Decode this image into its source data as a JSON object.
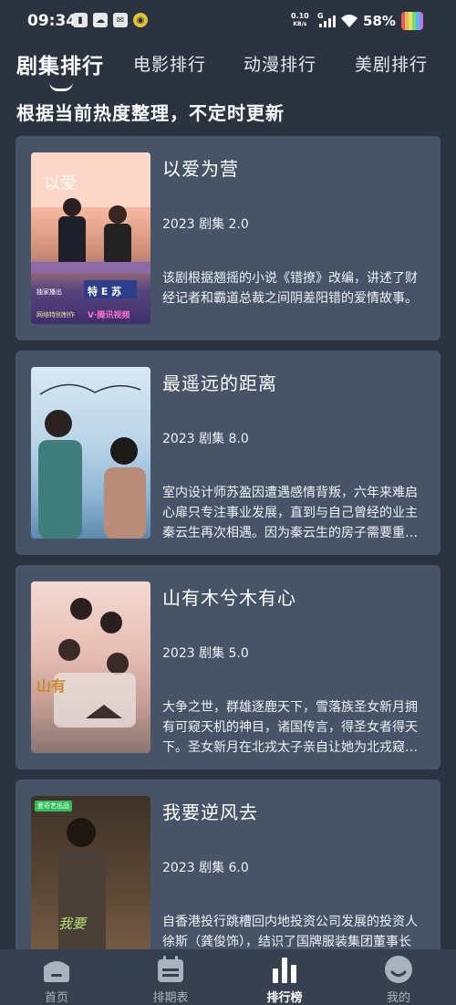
{
  "status_bar": {
    "time": "09:34",
    "net_speed_value": "0.10",
    "net_speed_unit": "KB/s",
    "network_label": "G",
    "battery": "58%"
  },
  "tabs": [
    {
      "label": "剧集排行",
      "active": true
    },
    {
      "label": "电影排行",
      "active": false
    },
    {
      "label": "动漫排行",
      "active": false
    },
    {
      "label": "美剧排行",
      "active": false
    }
  ],
  "subtitle": "根据当前热度整理，不定时更新",
  "items": [
    {
      "title": "以爱为营",
      "meta": "2023 剧集 2.0",
      "description": "该剧根据翘摇的小说《错撩》改编，讲述了财经记者和霸道总裁之间阴差阳错的爱情故事。",
      "poster_caption": "特 E 苏",
      "poster_tag": "独家播出",
      "poster_footer": "网络特别制作",
      "poster_brand": "V·腾讯视频"
    },
    {
      "title": "最遥远的距离",
      "meta": "2023 剧集 8.0",
      "description": "室内设计师苏盈因遭遇感情背叛，六年来难启心扉只专注事业发展，直到与自己曾经的业主秦云生再次相遇。因为秦云生的房子需要重新翻修，两人一起…"
    },
    {
      "title": "山有木兮木有心",
      "meta": "2023 剧集 5.0",
      "description": "大争之世，群雄逐鹿天下，雪落族圣女新月拥有可窥天机的神目，诸国传言，得圣女者得天下。圣女新月在北戎太子亲自让她为北戎窥得天机时，趁大火…"
    },
    {
      "title": "我要逆风去",
      "meta": "2023 剧集 6.0",
      "description": "自香港投行跳槽回内地投资公司发展的投资人徐斯（龚俊饰），结识了国牌服装集团董事长独生女江湖（钟楚曦",
      "poster_tag": "爱奇艺出品"
    }
  ],
  "bottom_nav": [
    {
      "label": "首页",
      "icon": "home-icon",
      "active": false
    },
    {
      "label": "排期表",
      "icon": "calendar-icon",
      "active": false
    },
    {
      "label": "排行榜",
      "icon": "ranking-icon",
      "active": true
    },
    {
      "label": "我的",
      "icon": "profile-icon",
      "active": false
    }
  ],
  "colors": {
    "background": "#2c3340",
    "card": "#475468",
    "nav_background": "#36404f",
    "text": "#ffffff"
  }
}
